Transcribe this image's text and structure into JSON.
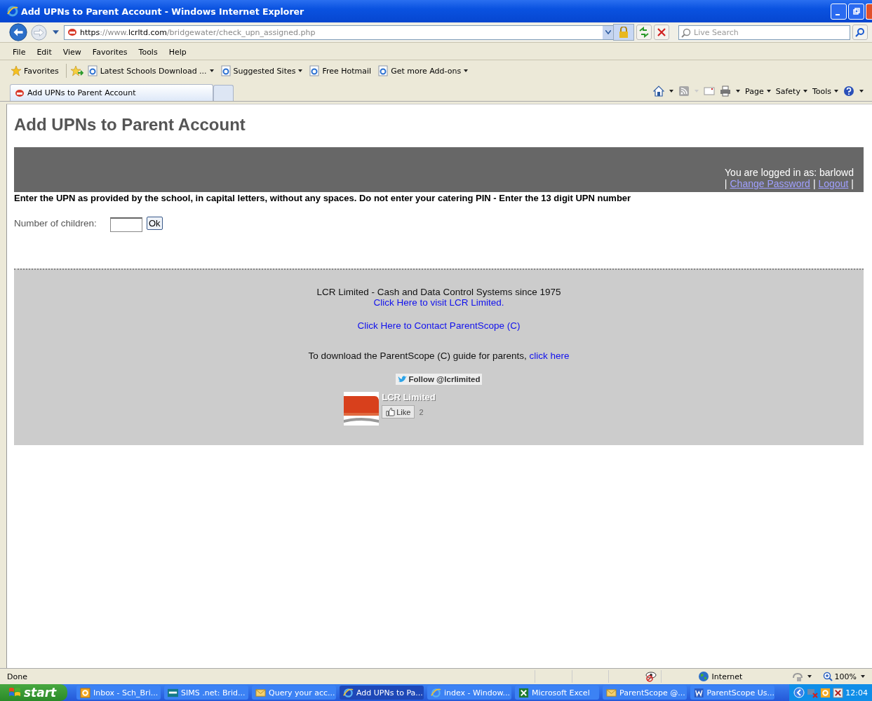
{
  "window": {
    "title": "Add UPNs to Parent Account - Windows Internet Explorer"
  },
  "address_bar": {
    "url_parts": [
      {
        "text": "https",
        "dim": false
      },
      {
        "text": "://www.",
        "dim": true
      },
      {
        "text": "lcrltd.com",
        "dim": false
      },
      {
        "text": "/bridgewater/check_upn_assigned.php",
        "dim": true
      }
    ]
  },
  "search": {
    "placeholder": "Live Search"
  },
  "menu": [
    "File",
    "Edit",
    "View",
    "Favorites",
    "Tools",
    "Help"
  ],
  "favorites_bar": {
    "label": "Favorites",
    "links": [
      {
        "label": "Latest Schools Download ...",
        "dropdown": true
      },
      {
        "label": "Suggested Sites",
        "dropdown": true
      },
      {
        "label": "Free Hotmail",
        "dropdown": false
      },
      {
        "label": "Get more Add-ons",
        "dropdown": true
      }
    ]
  },
  "tabs": [
    {
      "label": "Add UPNs to Parent Account",
      "selected": true
    }
  ],
  "command_bar": [
    "Page",
    "Safety",
    "Tools"
  ],
  "page": {
    "heading": "Add UPNs to Parent Account",
    "logged_in": "You are logged in as: barlowd",
    "account_links": [
      {
        "kind": "sep",
        "text": "|"
      },
      {
        "kind": "link",
        "text": "Change Password"
      },
      {
        "kind": "sep",
        "text": "|"
      },
      {
        "kind": "link",
        "text": "Logout"
      },
      {
        "kind": "sep",
        "text": "|"
      }
    ],
    "instruction": "Enter the UPN as provided by the school, in capital letters, without any spaces. Do not enter your catering PIN - Enter the 13 digit UPN number",
    "field_label": "Number of children:",
    "ok_button": "Ok",
    "footer": {
      "company": "LCR Limited - Cash and Data Control Systems since 1975",
      "visit_link": "Click Here to visit LCR Limited.",
      "contact_link": "Click Here to Contact ParentScope (C)",
      "guide_text": "To download the ParentScope (C) guide for parents,",
      "guide_link": "click here",
      "follow": "Follow @lcrlimited",
      "fb_name": "LCR Limited",
      "like": "Like",
      "like_count": "2"
    }
  },
  "status_bar": {
    "text": "Done",
    "zone": "Internet",
    "zoom": "100%"
  },
  "taskbar": {
    "start": "start",
    "items": [
      {
        "label": "Inbox - Sch_Bri...",
        "kind": "outlook",
        "selected": false
      },
      {
        "label": "SIMS .net: Brid...",
        "kind": "sims",
        "selected": false
      },
      {
        "label": "Query your acc...",
        "kind": "mail",
        "selected": false
      },
      {
        "label": "Add UPNs to Pa...",
        "kind": "ie",
        "selected": true
      },
      {
        "label": "index - Window...",
        "kind": "ie",
        "selected": false
      },
      {
        "label": "Microsoft Excel",
        "kind": "excel",
        "selected": false
      },
      {
        "label": "ParentScope @...",
        "kind": "mail",
        "selected": false
      },
      {
        "label": "ParentScope Us...",
        "kind": "word",
        "selected": false
      }
    ],
    "clock": "12:04"
  }
}
